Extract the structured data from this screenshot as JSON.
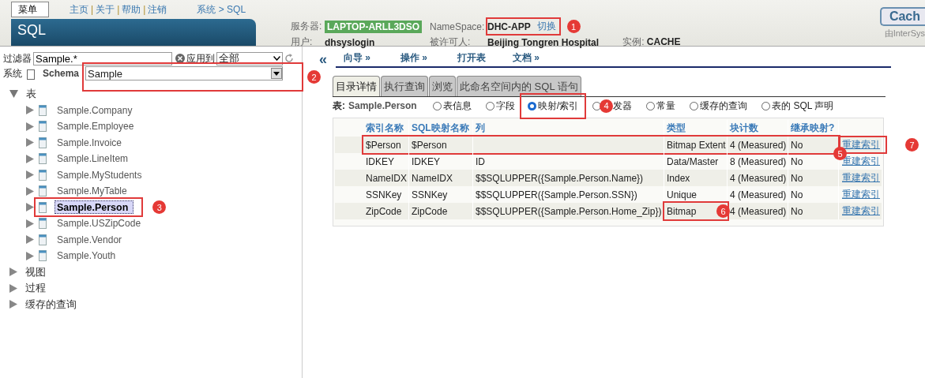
{
  "menu_button": "菜单",
  "top_links": [
    {
      "kind": "link",
      "text": "主页"
    },
    {
      "kind": "separator",
      "text": "|"
    },
    {
      "kind": "link",
      "text": "关于"
    },
    {
      "kind": "separator",
      "text": "|"
    },
    {
      "kind": "link",
      "text": "帮助"
    },
    {
      "kind": "separator",
      "text": "|"
    },
    {
      "kind": "link",
      "text": "注销"
    }
  ],
  "breadcrumb": "系统 > SQL",
  "page_title": "SQL",
  "server": {
    "label": "服务器:",
    "value": "LAPTOP-ARLL3DSO"
  },
  "namespace": {
    "label": "NameSpace:",
    "value": "DHC-APP",
    "switch_link": "切换",
    "highlighted": true,
    "marker": "1"
  },
  "user": {
    "label": "用户:",
    "value": "dhsyslogin"
  },
  "licensee": {
    "label": "被许可人:",
    "value": "Beijing Tongren Hospital"
  },
  "instance": {
    "label": "实例:",
    "value": "CACHE"
  },
  "product_button": "Cach",
  "product_note": "由InterSys",
  "filter": {
    "label": "过滤器",
    "value": "Sample.*",
    "apply_label": "应用到",
    "apply_value": "全部"
  },
  "system": {
    "label": "系统",
    "checked": false
  },
  "schema": {
    "label": "Schema",
    "value": "Sample",
    "highlighted": true,
    "marker": "2"
  },
  "tree": [
    {
      "label": "表",
      "expanded": true,
      "children": [
        {
          "label": "Sample.Company",
          "expanded": false,
          "selected": false,
          "highlighted": false
        },
        {
          "label": "Sample.Employee",
          "expanded": false,
          "selected": false,
          "highlighted": false
        },
        {
          "label": "Sample.Invoice",
          "expanded": false,
          "selected": false,
          "highlighted": false
        },
        {
          "label": "Sample.LineItem",
          "expanded": false,
          "selected": false,
          "highlighted": false
        },
        {
          "label": "Sample.MyStudents",
          "expanded": false,
          "selected": false,
          "highlighted": false
        },
        {
          "label": "Sample.MyTable",
          "expanded": false,
          "selected": false,
          "highlighted": false
        },
        {
          "label": "Sample.Person",
          "expanded": false,
          "selected": true,
          "highlighted": true,
          "marker": "3"
        },
        {
          "label": "Sample.USZipCode",
          "expanded": false,
          "selected": false,
          "highlighted": false
        },
        {
          "label": "Sample.Vendor",
          "expanded": false,
          "selected": false,
          "highlighted": false
        },
        {
          "label": "Sample.Youth",
          "expanded": false,
          "selected": false,
          "highlighted": false
        }
      ]
    },
    {
      "label": "视图",
      "expanded": false
    },
    {
      "label": "过程",
      "expanded": false
    },
    {
      "label": "缓存的查询",
      "expanded": false
    }
  ],
  "collapse_button": "«",
  "nav": [
    "向导 »",
    "操作 »",
    "打开表",
    "文档 »"
  ],
  "tabs": [
    {
      "label": "目录详情",
      "selected": true
    },
    {
      "label": "执行查询",
      "selected": false
    },
    {
      "label": "浏览",
      "selected": false
    },
    {
      "label": "此命名空间内的 SQL 语句",
      "selected": false
    }
  ],
  "table_label": "表:",
  "table_name": "Sample.Person",
  "views": [
    {
      "label": "表信息",
      "selected": false,
      "highlighted": false
    },
    {
      "label": "字段",
      "selected": false,
      "highlighted": false
    },
    {
      "label": "映射/索引",
      "selected": true,
      "highlighted": true
    },
    {
      "label": "发器",
      "selected": false,
      "highlighted": false,
      "marker": "4"
    },
    {
      "label": "常量",
      "selected": false,
      "highlighted": false
    },
    {
      "label": "缓存的查询",
      "selected": false,
      "highlighted": false
    },
    {
      "label": "表的 SQL 声明",
      "selected": false,
      "highlighted": false
    }
  ],
  "table": {
    "columns": [
      "索引名称",
      "SQL映射名称",
      "列",
      "类型",
      "块计数",
      "继承映射?"
    ],
    "rows": [
      {
        "cells": [
          "$Person",
          "$Person",
          "",
          "Bitmap Extent",
          "4 (Measured)",
          "No"
        ],
        "action": "重建索引",
        "highlighted": true,
        "marker": "5",
        "type_highlighted": false,
        "action_highlighted": true,
        "action_marker": "7"
      },
      {
        "cells": [
          "IDKEY",
          "IDKEY",
          "ID",
          "Data/Master",
          "8 (Measured)",
          "No"
        ],
        "action": "重建索引",
        "highlighted": false,
        "type_highlighted": false,
        "action_highlighted": false
      },
      {
        "cells": [
          "NameIDX",
          "NameIDX",
          "$$SQLUPPER({Sample.Person.Name})",
          "Index",
          "4 (Measured)",
          "No"
        ],
        "action": "重建索引",
        "highlighted": false,
        "type_highlighted": false,
        "action_highlighted": false
      },
      {
        "cells": [
          "SSNKey",
          "SSNKey",
          "$$SQLUPPER({Sample.Person.SSN})",
          "Unique",
          "4 (Measured)",
          "No"
        ],
        "action": "重建索引",
        "highlighted": false,
        "type_highlighted": false,
        "action_highlighted": false
      },
      {
        "cells": [
          "ZipCode",
          "ZipCode",
          "$$SQLUPPER({Sample.Person.Home_Zip})",
          "Bitmap",
          "4 (Measured)",
          "No"
        ],
        "action": "重建索引",
        "highlighted": false,
        "type_highlighted": true,
        "type_marker": "6",
        "action_highlighted": false
      }
    ]
  }
}
